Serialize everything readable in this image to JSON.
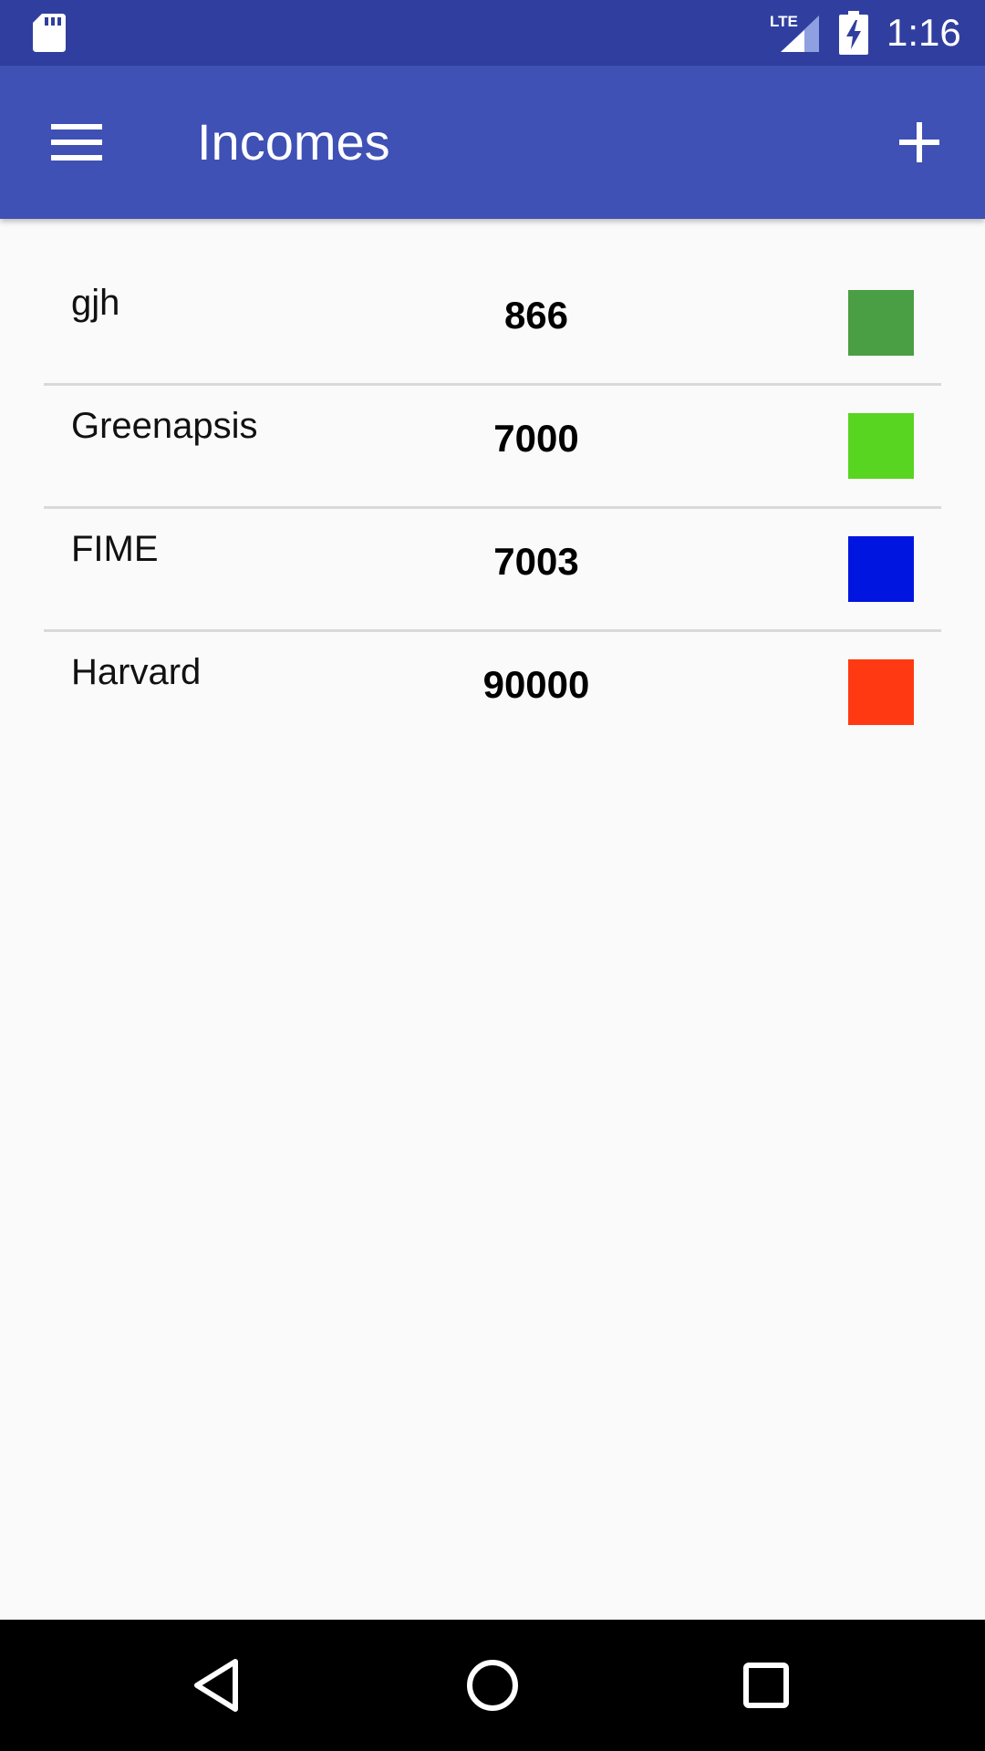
{
  "status_bar": {
    "time": "1:16",
    "network_label": "LTE",
    "icons": [
      "sd-card-icon",
      "lte-signal-icon",
      "battery-charging-icon"
    ]
  },
  "app_bar": {
    "title": "Incomes",
    "menu_icon": "hamburger-menu-icon",
    "add_icon": "plus-icon"
  },
  "incomes": [
    {
      "name": "gjh",
      "amount": "866",
      "color": "#4a9e44"
    },
    {
      "name": "Greenapsis",
      "amount": "7000",
      "color": "#58d520"
    },
    {
      "name": "FIME",
      "amount": "7003",
      "color": "#0016e0"
    },
    {
      "name": "Harvard",
      "amount": "90000",
      "color": "#ff3a12"
    }
  ],
  "nav_bar": {
    "icons": [
      "back-icon",
      "home-icon",
      "recents-icon"
    ]
  },
  "colors": {
    "status_bar": "#303f9f",
    "app_bar": "#3f51b5",
    "background": "#fafafa",
    "divider": "#d9d9d9"
  }
}
